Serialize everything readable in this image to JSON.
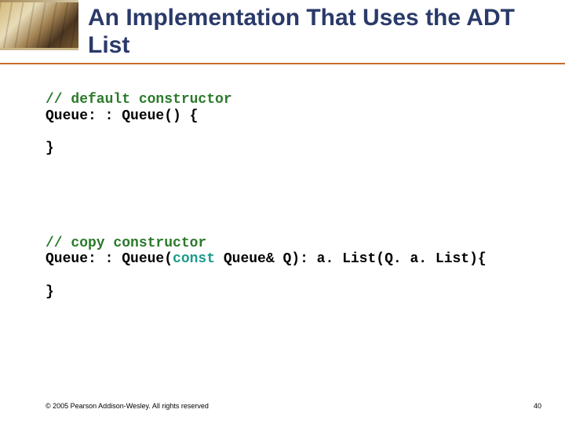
{
  "title": "An Implementation That Uses the ADT List",
  "code": {
    "default_comment": "// default constructor",
    "default_signature": "Queue: : Queue() {",
    "default_close": "}",
    "copy_comment": "// copy constructor",
    "copy_sig_pre": "Queue: : Queue(",
    "copy_sig_keyword": "const",
    "copy_sig_post": " Queue& Q): a. List(Q. a. List){",
    "copy_close": "}"
  },
  "footer": {
    "copyright": "© 2005 Pearson Addison-Wesley. All rights reserved",
    "page_number": "40"
  }
}
